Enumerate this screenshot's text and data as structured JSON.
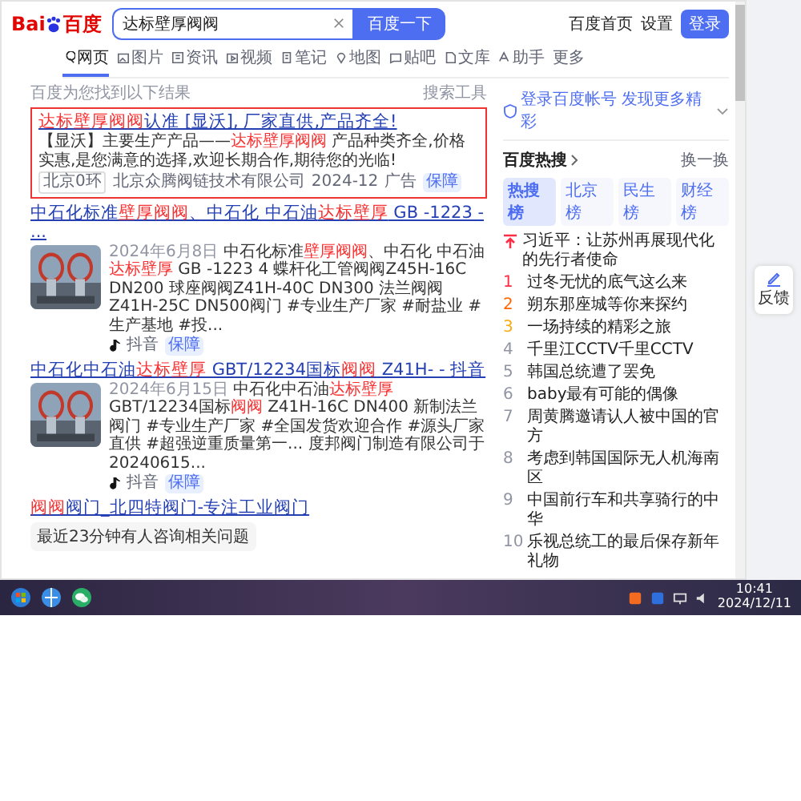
{
  "logo": {
    "latin": "Bai",
    "cjk": "百度"
  },
  "search": {
    "value": "达标壁厚阀阀",
    "button": "百度一下"
  },
  "top_links": [
    "百度首页",
    "设置"
  ],
  "login_button": "登录",
  "tabs": [
    {
      "label": "网页",
      "selected": true
    },
    {
      "label": "图片",
      "selected": false
    },
    {
      "label": "资讯",
      "selected": false
    },
    {
      "label": "视频",
      "selected": false
    },
    {
      "label": "笔记",
      "selected": false
    },
    {
      "label": "地图",
      "selected": false
    },
    {
      "label": "贴吧",
      "selected": false
    },
    {
      "label": "文库",
      "selected": false
    },
    {
      "label": "助手",
      "selected": false
    },
    {
      "label": "更多",
      "selected": false
    }
  ],
  "result_info": "百度为您找到以下结果",
  "search_tools": "搜索工具",
  "results": [
    {
      "kind": "ad",
      "title": [
        {
          "text": "达标壁厚阀阀",
          "highlight": true
        },
        {
          "text": "认准 [显沃], 厂家直供,产品齐全!",
          "highlight": false
        }
      ],
      "description": [
        {
          "text": "【显沃】主要生产产品——",
          "highlight": false
        },
        {
          "text": "达标壁厚阀阀",
          "highlight": true
        },
        {
          "text": " 产品种类齐全,价格实惠,是您满意的选择,欢迎长期合作,期待您的光临!",
          "highlight": false
        }
      ],
      "tag": "北京0环",
      "source": "北京众腾阀链技术有限公司",
      "date": "2024-12",
      "ad_label": "广告",
      "badge": "保障"
    },
    {
      "kind": "video",
      "title": [
        {
          "text": "中石化标准",
          "highlight": false
        },
        {
          "text": "壁厚阀阀",
          "highlight": true
        },
        {
          "text": "、中石化 中石油",
          "highlight": false
        },
        {
          "text": "达标壁厚",
          "highlight": true
        },
        {
          "text": " GB -1223 - ...",
          "highlight": false
        }
      ],
      "date": "2024年6月8日",
      "description": [
        {
          "text": " 中石化标准",
          "highlight": false
        },
        {
          "text": "壁厚阀阀",
          "highlight": true
        },
        {
          "text": "、中石化 中石油",
          "highlight": false
        },
        {
          "text": "达标壁厚",
          "highlight": true
        },
        {
          "text": " GB -1223 4 蝶杆化工管阀阀Z45H-16C DN200 球座阀阀Z41H-40C DN300 法兰阀阀Z41H-25C DN500阀门 #专业生产厂家 #耐盐业 #生产基地 #投...",
          "highlight": false
        }
      ],
      "source": "抖音",
      "badge": "保障"
    },
    {
      "kind": "video",
      "title": [
        {
          "text": "中石化中石油",
          "highlight": false
        },
        {
          "text": "达标壁厚",
          "highlight": true
        },
        {
          "text": " GBT/12234国标",
          "highlight": false
        },
        {
          "text": "阀阀",
          "highlight": true
        },
        {
          "text": " Z41H- - 抖音",
          "highlight": false
        }
      ],
      "date": "2024年6月15日",
      "description": [
        {
          "text": " 中石化中石油",
          "highlight": false
        },
        {
          "text": "达标壁厚",
          "highlight": true
        },
        {
          "text": " GBT/12234国标",
          "highlight": false
        },
        {
          "text": "阀阀",
          "highlight": true
        },
        {
          "text": " Z41H-16C DN400 新制法兰阀门 #专业生产厂家 #全国发货欢迎合作 #源头厂家直供 #超强逆重质量第一... 度邦阀门制造有限公司于20240615...",
          "highlight": false
        }
      ],
      "source": "抖音",
      "badge": "保障"
    },
    {
      "kind": "qa",
      "title": [
        {
          "text": "阀阀",
          "highlight": true
        },
        {
          "text": "阀门_北四特阀门-专注工业阀门",
          "highlight": false
        }
      ],
      "chip": "最近23分钟有人咨询相关问题"
    }
  ],
  "sidebar": {
    "account": "登录百度帐号 发现更多精彩",
    "hot_title": "百度热搜",
    "refresh": "换一换",
    "boards": [
      {
        "label": "热搜榜",
        "selected": true
      },
      {
        "label": "北京榜",
        "selected": false
      },
      {
        "label": "民生榜",
        "selected": false
      },
      {
        "label": "财经榜",
        "selected": false
      }
    ],
    "hot_items": [
      {
        "kind": "pinned",
        "text": "习近平：让苏州再展现代化的先行者使命"
      },
      {
        "kind": "ranked",
        "rank": "1",
        "color": "#fe2d46",
        "text": "过冬无忧的底气这么来"
      },
      {
        "kind": "ranked",
        "rank": "2",
        "color": "#ff6600",
        "text": "朔东那座城等你来探约"
      },
      {
        "kind": "ranked",
        "rank": "3",
        "color": "#faa90e",
        "text": "一场持续的精彩之旅"
      },
      {
        "kind": "ranked",
        "rank": "4",
        "color": "#9195a3",
        "text": "千里江CCTV千里CCTV"
      },
      {
        "kind": "ranked",
        "rank": "5",
        "color": "#9195a3",
        "text": "韩国总统遭了罢免"
      },
      {
        "kind": "ranked",
        "rank": "6",
        "color": "#9195a3",
        "text": "baby最有可能的偶像"
      },
      {
        "kind": "ranked",
        "rank": "7",
        "color": "#9195a3",
        "text": "周黄腾邀请认人被中国的官方"
      },
      {
        "kind": "ranked",
        "rank": "8",
        "color": "#9195a3",
        "text": "考虑到韩国国际无人机海南区"
      },
      {
        "kind": "ranked",
        "rank": "9",
        "color": "#9195a3",
        "text": "中国前行车和共享骑行的中华"
      },
      {
        "kind": "ranked",
        "rank": "10",
        "color": "#9195a3",
        "text": "乐视总统工的最后保存新年礼物"
      }
    ]
  },
  "feedback": "反馈",
  "taskbar": {
    "time": "10:41",
    "date": "2024/12/11"
  }
}
